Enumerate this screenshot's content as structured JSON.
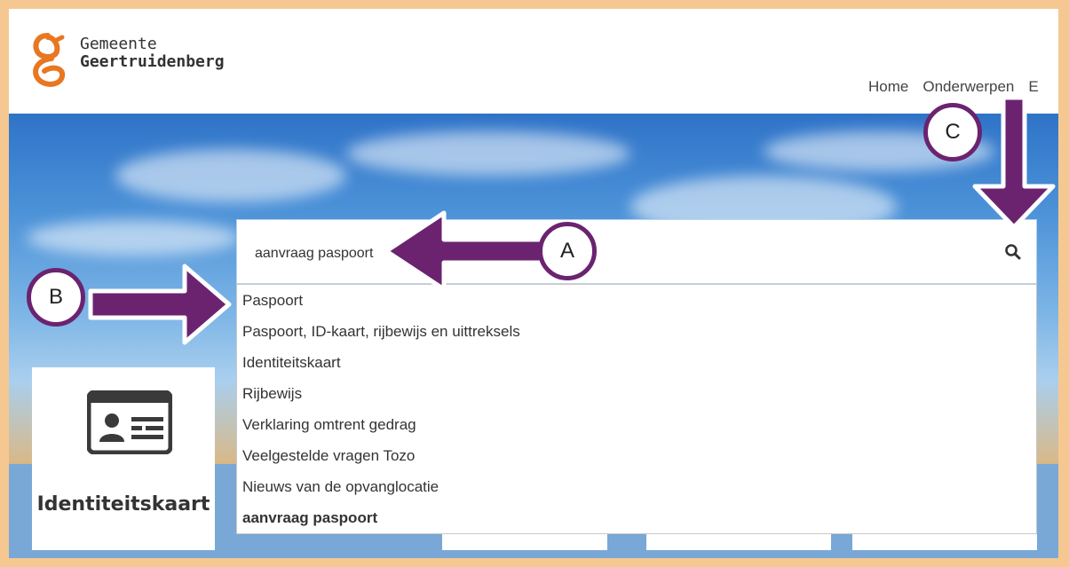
{
  "header": {
    "logo_line1": "Gemeente",
    "logo_line2": "Geertruidenberg",
    "brand_color": "#e87722",
    "nav": [
      "Home",
      "Onderwerpen",
      "E"
    ]
  },
  "search": {
    "value": "aanvraag paspoort",
    "icon": "search-icon"
  },
  "suggestions": [
    "Paspoort",
    "Paspoort, ID-kaart, rijbewijs en uittreksels",
    "Identiteitskaart",
    "Rijbewijs",
    "Verklaring omtrent gedrag",
    "Veelgestelde vragen Tozo",
    "Nieuws van de opvanglocatie",
    "aanvraag paspoort"
  ],
  "card": {
    "title": "Identiteitskaart",
    "icon": "id-card-icon"
  },
  "annotations": {
    "a": "A",
    "b": "B",
    "c": "C",
    "arrow_color": "#6b2370"
  }
}
